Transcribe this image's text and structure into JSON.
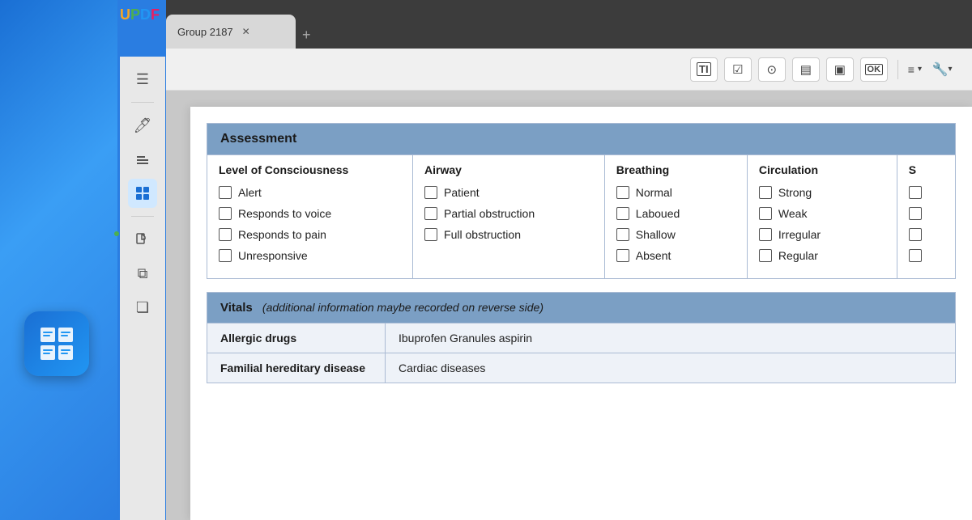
{
  "app": {
    "name": "UPDF",
    "letters": [
      "U",
      "P",
      "D",
      "F"
    ],
    "colors": [
      "#f5a623",
      "#4caf50",
      "#2196f3",
      "#e91e63"
    ]
  },
  "tabs": [
    {
      "label": "Group 2187",
      "active": true
    },
    {
      "label": "+",
      "active": false
    }
  ],
  "toolbar": {
    "buttons": [
      "TI",
      "☑",
      "⊙",
      "▤",
      "▣",
      "OK"
    ]
  },
  "sidebar": {
    "items": [
      {
        "icon": "≡",
        "name": "pages",
        "active": false
      },
      {
        "icon": "✏",
        "name": "annotate",
        "active": false
      },
      {
        "icon": "✎",
        "name": "edit",
        "active": false
      },
      {
        "icon": "▦",
        "name": "organize",
        "active": true
      },
      {
        "icon": "⎘",
        "name": "export",
        "active": false
      },
      {
        "icon": "⧉",
        "name": "convert",
        "active": false
      },
      {
        "icon": "❏",
        "name": "protect",
        "active": false
      }
    ]
  },
  "assessment": {
    "title": "Assessment",
    "columns": [
      {
        "header": "Level of Consciousness",
        "items": [
          "Alert",
          "Responds to voice",
          "Responds to pain",
          "Unresponsive"
        ]
      },
      {
        "header": "Airway",
        "items": [
          "Patient",
          "Partial obstruction",
          "Full obstruction"
        ]
      },
      {
        "header": "Breathing",
        "items": [
          "Normal",
          "Laboued",
          "Shallow",
          "Absent"
        ]
      },
      {
        "header": "Circulation",
        "items": [
          "Strong",
          "Weak",
          "Irregular",
          "Regular"
        ]
      },
      {
        "header": "S",
        "items": [
          "",
          "",
          "",
          ""
        ]
      }
    ]
  },
  "vitals": {
    "title": "Vitals",
    "note": "(additional information maybe recorded on reverse side)",
    "rows": [
      {
        "label": "Allergic drugs",
        "value": "Ibuprofen Granules  aspirin"
      },
      {
        "label": "Familial hereditary disease",
        "value": "Cardiac diseases"
      }
    ]
  }
}
